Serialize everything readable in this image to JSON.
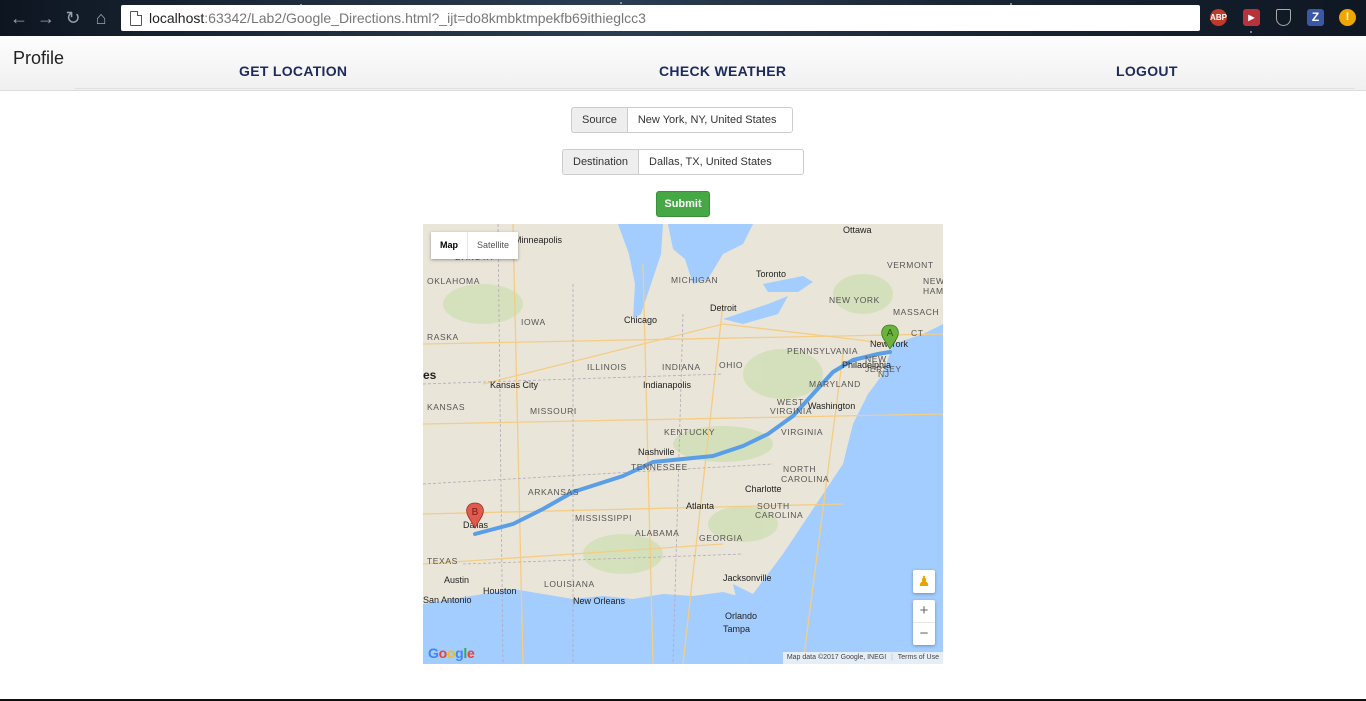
{
  "browser": {
    "url_host": "localhost",
    "url_rest": ":63342/Lab2/Google_Directions.html?_ijt=do8kmbktmpekfb69ithieglcc3",
    "extensions": [
      {
        "name": "adblock-icon",
        "label": "ABP",
        "color": "#c0392b"
      },
      {
        "name": "video-ext-icon",
        "label": "",
        "color": "#b8323b"
      },
      {
        "name": "shield-icon",
        "label": "",
        "color": "#555"
      },
      {
        "name": "z-ext-icon",
        "label": "Z",
        "color": "#3b58a8"
      },
      {
        "name": "alert-icon",
        "label": "!",
        "color": "#f0a500"
      }
    ]
  },
  "header": {
    "brand": "Profile",
    "nav": [
      "GET LOCATION",
      "CHECK WEATHER",
      "LOGOUT"
    ]
  },
  "form": {
    "source_label": "Source",
    "source_value": "New York, NY, United States",
    "destination_label": "Destination",
    "destination_value": "Dallas, TX, United States",
    "submit_label": "Submit"
  },
  "map": {
    "type_map": "Map",
    "type_satellite": "Satellite",
    "marker_a": "A",
    "marker_b": "B",
    "attribution": "Map data ©2017 Google, INEGI",
    "terms": "Terms of Use",
    "logo": "Google",
    "zoom_in": "+",
    "zoom_out": "−",
    "route_color": "#5a9ee8",
    "water_color": "#a3ccff",
    "land_color": "#e9e5d8"
  }
}
